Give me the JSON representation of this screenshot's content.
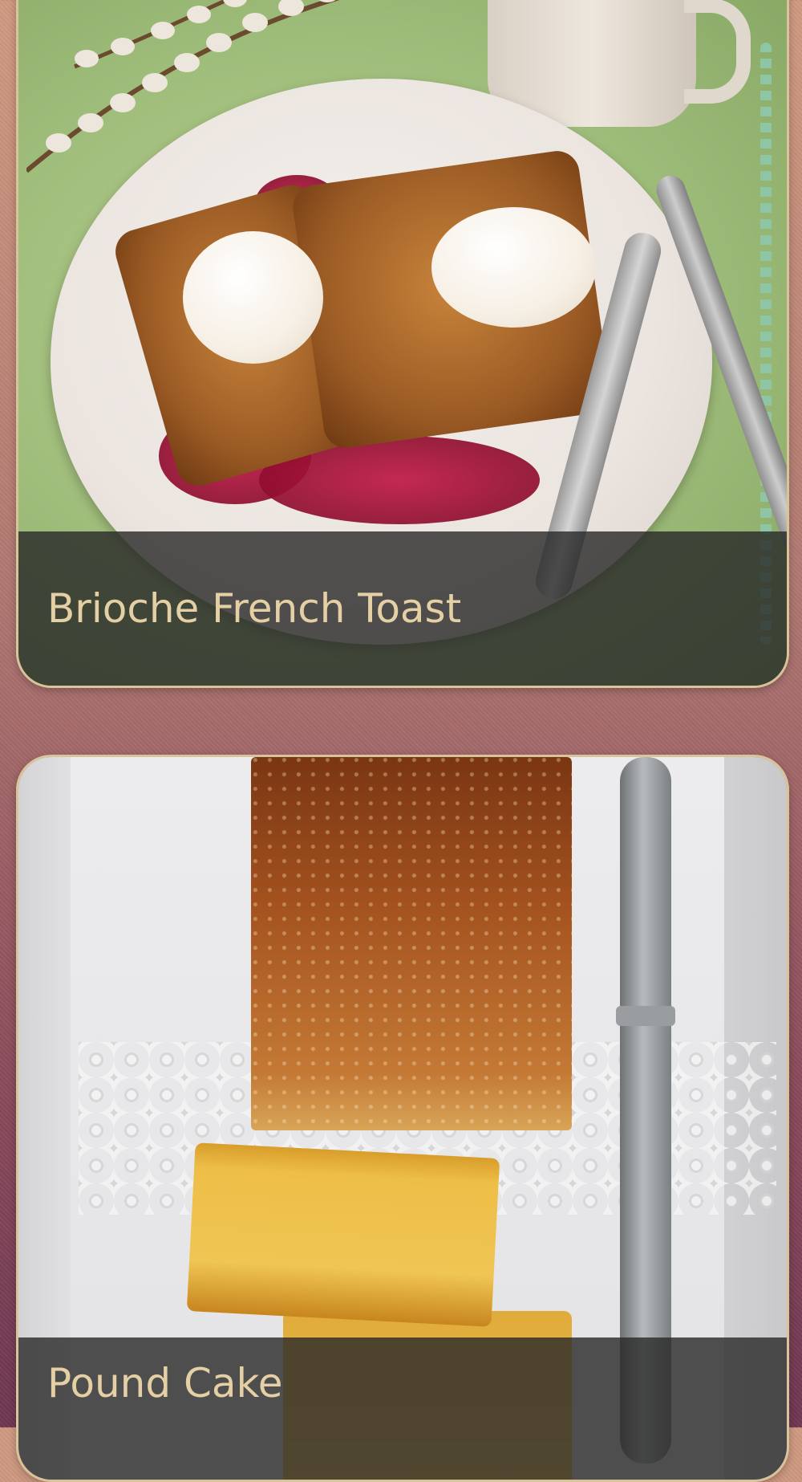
{
  "recipes": [
    {
      "title": "Brioche French Toast",
      "photo_icon": "french-toast-photo"
    },
    {
      "title": "Pound Cake",
      "photo_icon": "pound-cake-photo"
    }
  ],
  "colors": {
    "caption_text": "#e5cfa4",
    "card_border": "#d9c39a",
    "caption_bg": "#282828"
  }
}
